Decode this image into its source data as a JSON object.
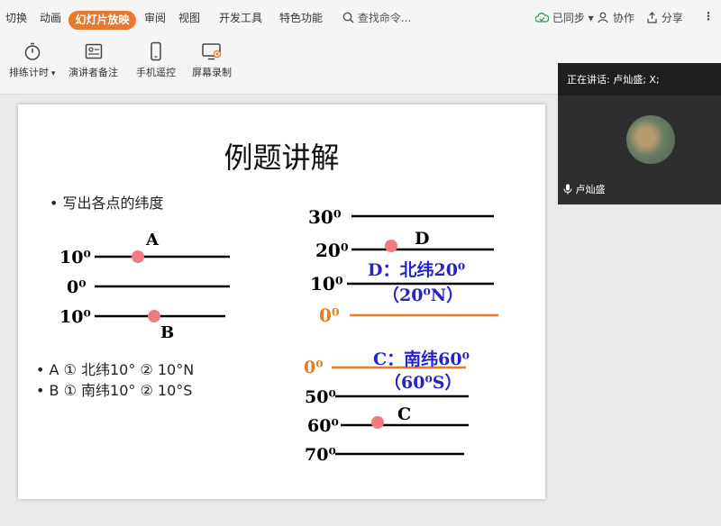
{
  "menu": {
    "items": [
      "切换",
      "动画",
      "幻灯片放映",
      "审阅",
      "视图",
      "开发工具",
      "特色功能"
    ],
    "active": "幻灯片放映",
    "search_placeholder": "查找命令...",
    "sync": "已同步",
    "collab": "协作",
    "share": "分享",
    "more": "⋮"
  },
  "ribbon": {
    "tools": [
      {
        "label": "排练计时",
        "icon": "stopwatch-icon"
      },
      {
        "label": "演讲者备注",
        "icon": "notes-icon"
      },
      {
        "label": "手机遥控",
        "icon": "phone-icon"
      },
      {
        "label": "屏幕录制",
        "icon": "screen-record-icon"
      }
    ]
  },
  "slide": {
    "title": "例题讲解",
    "bullet1": "•  写出各点的纬度",
    "answers": [
      "•  A ① 北纬10° ② 10°N",
      "•  B ① 南纬10° ② 10°S"
    ],
    "left_diagram": {
      "labels": [
        "10⁰",
        "0⁰",
        "10⁰"
      ],
      "points": [
        "A",
        "B"
      ]
    },
    "right_top": {
      "labels": [
        "30⁰",
        "20⁰",
        "10⁰",
        "0⁰"
      ],
      "point": "D",
      "answer_line1": "D：北纬20⁰",
      "answer_line2": "（20⁰N）"
    },
    "right_bottom": {
      "labels": [
        "0⁰",
        "50⁰",
        "60⁰",
        "70⁰"
      ],
      "point": "C",
      "answer_line1": "C：南纬60⁰",
      "answer_line2": "（60⁰S）"
    },
    "colors": {
      "orange": "#e77b1f",
      "blue": "#2323c8",
      "dot": "#ef7a80"
    }
  },
  "video": {
    "speaking": "正在讲话: 卢灿盛; X;",
    "name": "卢灿盛"
  }
}
